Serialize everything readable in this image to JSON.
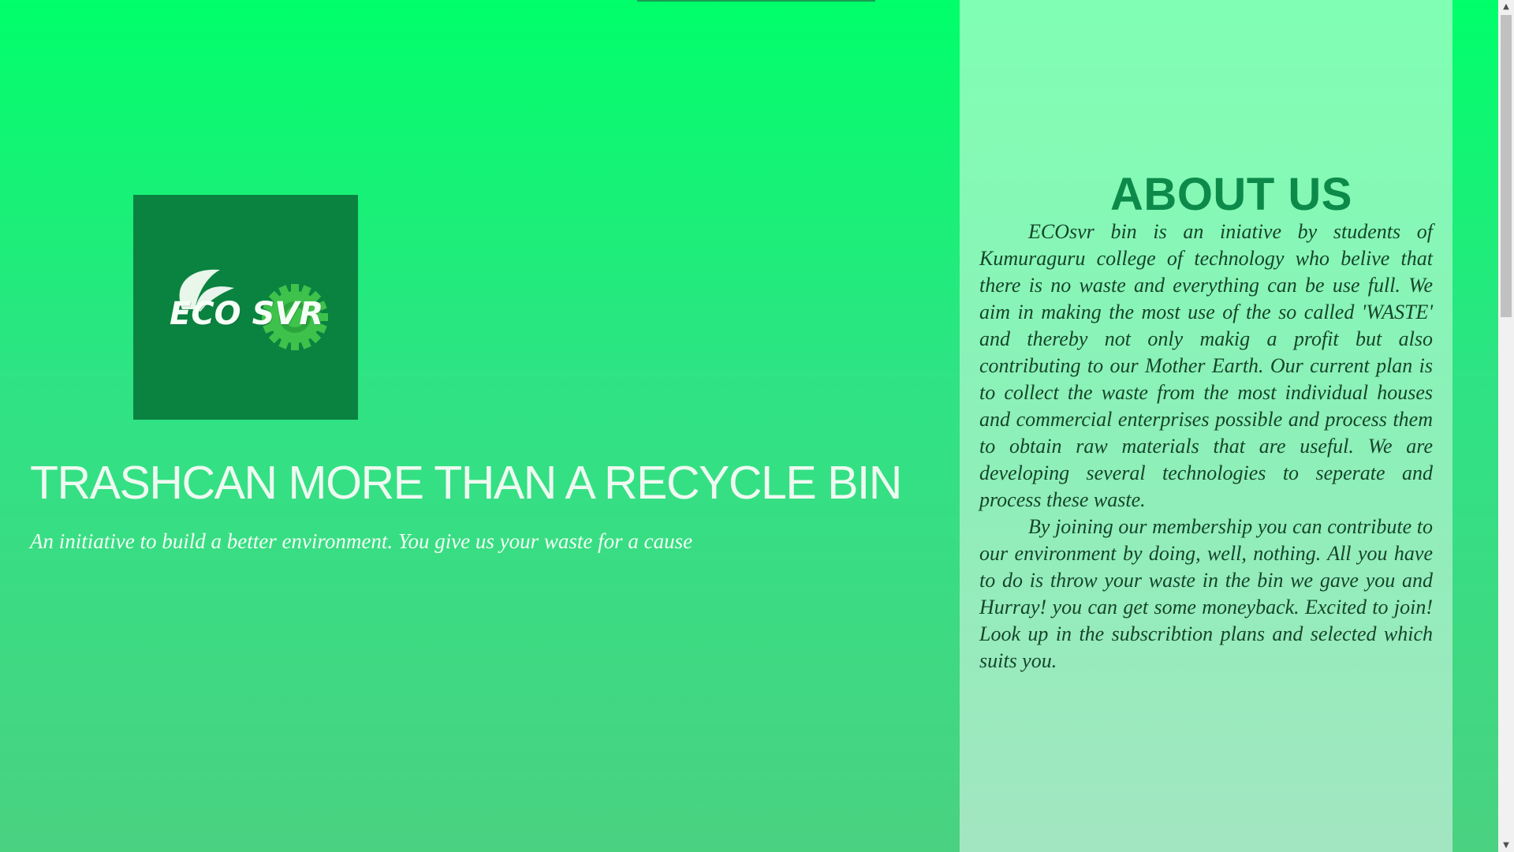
{
  "hero": {
    "logo_text": "ECO SVR",
    "title": "TRASHCAN MORE THAN A RECYCLE BIN",
    "subtitle": "An initiative to build a better environment. You give us your waste for a cause"
  },
  "about": {
    "title": "ABOUT US",
    "paragraphs": [
      "ECOsvr bin is an iniative by students of Kumuraguru college of technology who belive that there is no waste and everything can be use full. We aim in making the most use of the so called 'WASTE' and thereby not only makig a profit but also contributing to our Mother Earth. Our current plan is to collect the waste from the most individual houses and commercial enterprises possible and process them to obtain raw materials that are useful. We are developing several technologies to seperate and process these waste.",
      "By joining our membership you can contribute to our environment by doing, well, nothing. All you have to do is throw your waste in the bin we gave you and Hurray! you can get some moneyback. Excited to join! Look up in the subscribtion plans and selected which suits you."
    ]
  },
  "scrollbar": {
    "up_icon": "triangle-up",
    "down_icon": "triangle-down",
    "up_glyph": "▲",
    "down_glyph": "▼"
  },
  "colors": {
    "hero_gradient_top": "#00ff6a",
    "hero_gradient_bottom": "#4ad281",
    "logo_bg": "#0a8340",
    "about_bg": "#80ffb4",
    "about_title": "#0c8a4a",
    "about_text": "#15452b"
  }
}
